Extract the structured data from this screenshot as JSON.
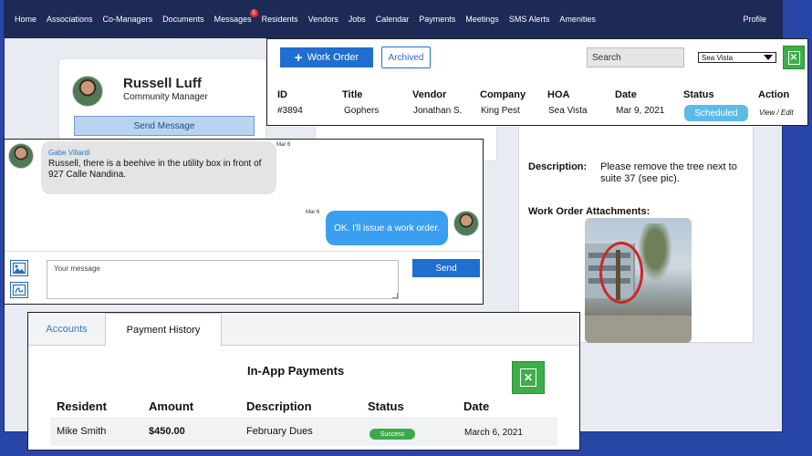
{
  "nav": {
    "items": [
      "Home",
      "Associations",
      "Co-Managers",
      "Documents",
      "Messages",
      "Residents",
      "Vendors",
      "Jobs",
      "Calendar",
      "Payments",
      "Meetings",
      "SMS Alerts",
      "Amenities"
    ],
    "messages_badge": "5",
    "profile": "Profile"
  },
  "profile": {
    "name": "Russell Luff",
    "role": "Community Manager",
    "send_message": "Send Message"
  },
  "work_orders": {
    "new_button": "Work Order",
    "archived_button": "Archived",
    "search_placeholder": "Search",
    "hoa_selected": "Sea Vista",
    "columns": [
      "ID",
      "Title",
      "Vendor",
      "Company",
      "HOA",
      "Date",
      "Status",
      "Action"
    ],
    "row": {
      "id": "#3894",
      "title": "Gophers",
      "vendor": "Jonathan S.",
      "company": "King Pest",
      "hoa": "Sea Vista",
      "date": "Mar 9, 2021",
      "status": "Scheduled",
      "action": "View / Edit"
    },
    "status_color": "#5bbbe8"
  },
  "work_order_detail": {
    "description_label": "Description:",
    "description": "Please remove the tree next to suite 37 (see pic).",
    "attachments_label": "Work Order Attachments:"
  },
  "messages": {
    "incoming": {
      "sender": "Gabe Villardi",
      "text": "Russell, there is a beehive in the utility box in front of 927 Calle Nandina.",
      "time": "Mar 6"
    },
    "outgoing": {
      "text": "OK. I'll issue a work order.",
      "time": "Mar 6"
    },
    "input_placeholder": "Your message",
    "send_button": "Send"
  },
  "payments": {
    "tabs": [
      "Accounts",
      "Payment History"
    ],
    "active_tab": "Payment History",
    "title": "In-App Payments",
    "columns": [
      "Resident",
      "Amount",
      "Description",
      "Status",
      "Date"
    ],
    "rows": [
      {
        "resident": "Mike Smith",
        "amount": "$450.00",
        "description": "February Dues",
        "status": "Success",
        "date": "March 6, 2021"
      }
    ],
    "success_color": "#3daa4a"
  },
  "colors": {
    "brand_blue": "#1f6fd0",
    "navbar": "#1e2a56",
    "background": "#2846a8",
    "excel_green": "#3dae49"
  }
}
